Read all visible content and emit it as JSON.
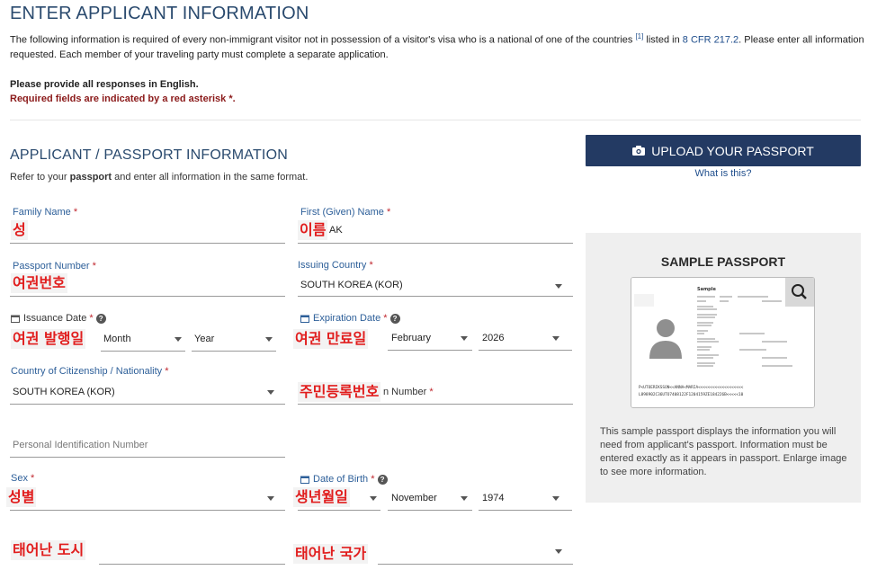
{
  "header": {
    "title": "ENTER APPLICANT INFORMATION",
    "intro_part1": "The following information is required of every non-immigrant visitor not in possession of a visitor's visa who is a national of one of the countries ",
    "intro_footnote": "[1]",
    "intro_part2": " listed in ",
    "intro_link": "8 CFR 217.2",
    "intro_part3": ". Please enter all information requested. Each member of your traveling party must complete a separate application.",
    "english_notice": "Please provide all responses in English.",
    "required_notice": "Required fields are indicated by a red asterisk *."
  },
  "section": {
    "title": "APPLICANT / PASSPORT INFORMATION",
    "refer_part1": "Refer to your ",
    "refer_bold": "passport",
    "refer_part2": " and enter all information in the same format."
  },
  "upload": {
    "button_label": "UPLOAD YOUR PASSPORT",
    "what_is_this": "What is this?"
  },
  "sample": {
    "title": "SAMPLE PASSPORT",
    "description": "This sample passport displays the information you will need from applicant's passport. Information must be entered exactly as it appears in passport. Enlarge image to see more information.",
    "passport_word": "Sample",
    "mrz1": "P<UTOERIKSSON<<ANNA<MARIA<<<<<<<<<<<<<<<<<<<",
    "mrz2": "L898902C36UTO7408122F1204159ZE184226B<<<<<10"
  },
  "form": {
    "required_star": "*",
    "family_name": {
      "label": "Family Name",
      "overlay": "성"
    },
    "first_name": {
      "label": "First (Given) Name",
      "overlay": "이름",
      "value_fragment": "AK"
    },
    "passport_number": {
      "label": "Passport Number",
      "overlay": "여권번호"
    },
    "issuing_country": {
      "label": "Issuing Country",
      "value": "SOUTH KOREA (KOR)"
    },
    "issuance_date": {
      "label": "Issuance Date",
      "overlay": "여권 발행일",
      "month": "Month",
      "year": "Year"
    },
    "expiration_date": {
      "label": "Expiration Date",
      "overlay": "여권 만료일",
      "month": "February",
      "year": "2026"
    },
    "citizenship": {
      "label": "Country of Citizenship / Nationality",
      "value": "SOUTH KOREA (KOR)"
    },
    "national_id": {
      "label_fragment": "n Number",
      "overlay": "주민등록번호"
    },
    "personal_id": {
      "placeholder": "Personal Identification Number"
    },
    "sex": {
      "label": "Sex",
      "overlay": "성별"
    },
    "date_of_birth": {
      "label": "Date of Birth",
      "overlay": "생년월일",
      "month": "November",
      "year": "1974"
    },
    "birth_city": {
      "overlay": "태어난 도시"
    },
    "birth_country": {
      "overlay": "태어난 국가"
    }
  }
}
